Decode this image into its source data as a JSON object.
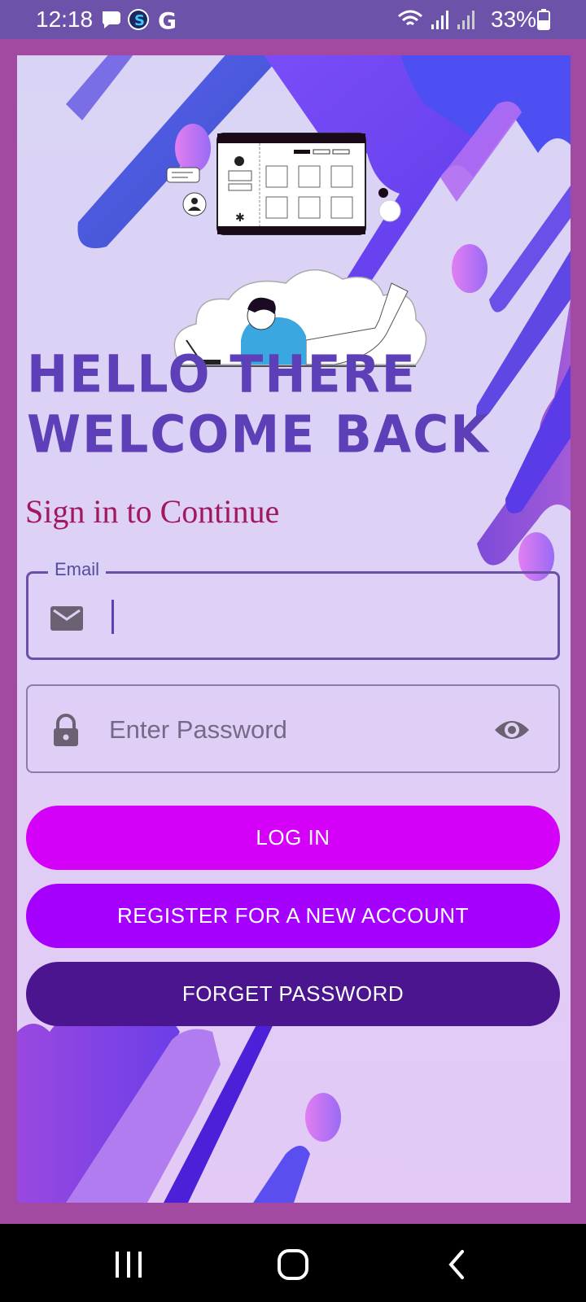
{
  "status_bar": {
    "time": "12:18",
    "battery": "33%",
    "icons": [
      "chat-bubble-icon",
      "app-s-icon",
      "google-g-icon",
      "wifi-icon",
      "signal-icon",
      "signal-icon",
      "battery-icon"
    ]
  },
  "hero": {
    "title_line1": "HELLO THERE",
    "title_line2": "WELCOME BACK",
    "subtitle": "Sign in to Continue"
  },
  "form": {
    "email_label": "Email",
    "email_value": "",
    "password_placeholder": "Enter Password"
  },
  "buttons": {
    "login": "LOG IN",
    "register": "REGISTER FOR A NEW ACCOUNT",
    "forget": "FORGET PASSWORD"
  },
  "colors": {
    "title": "#5d3fb8",
    "subtitle": "#a2185f",
    "login": "#d400f7",
    "register": "#a500fd",
    "forget": "#4b1590",
    "frame_border": "#a24aa1"
  }
}
